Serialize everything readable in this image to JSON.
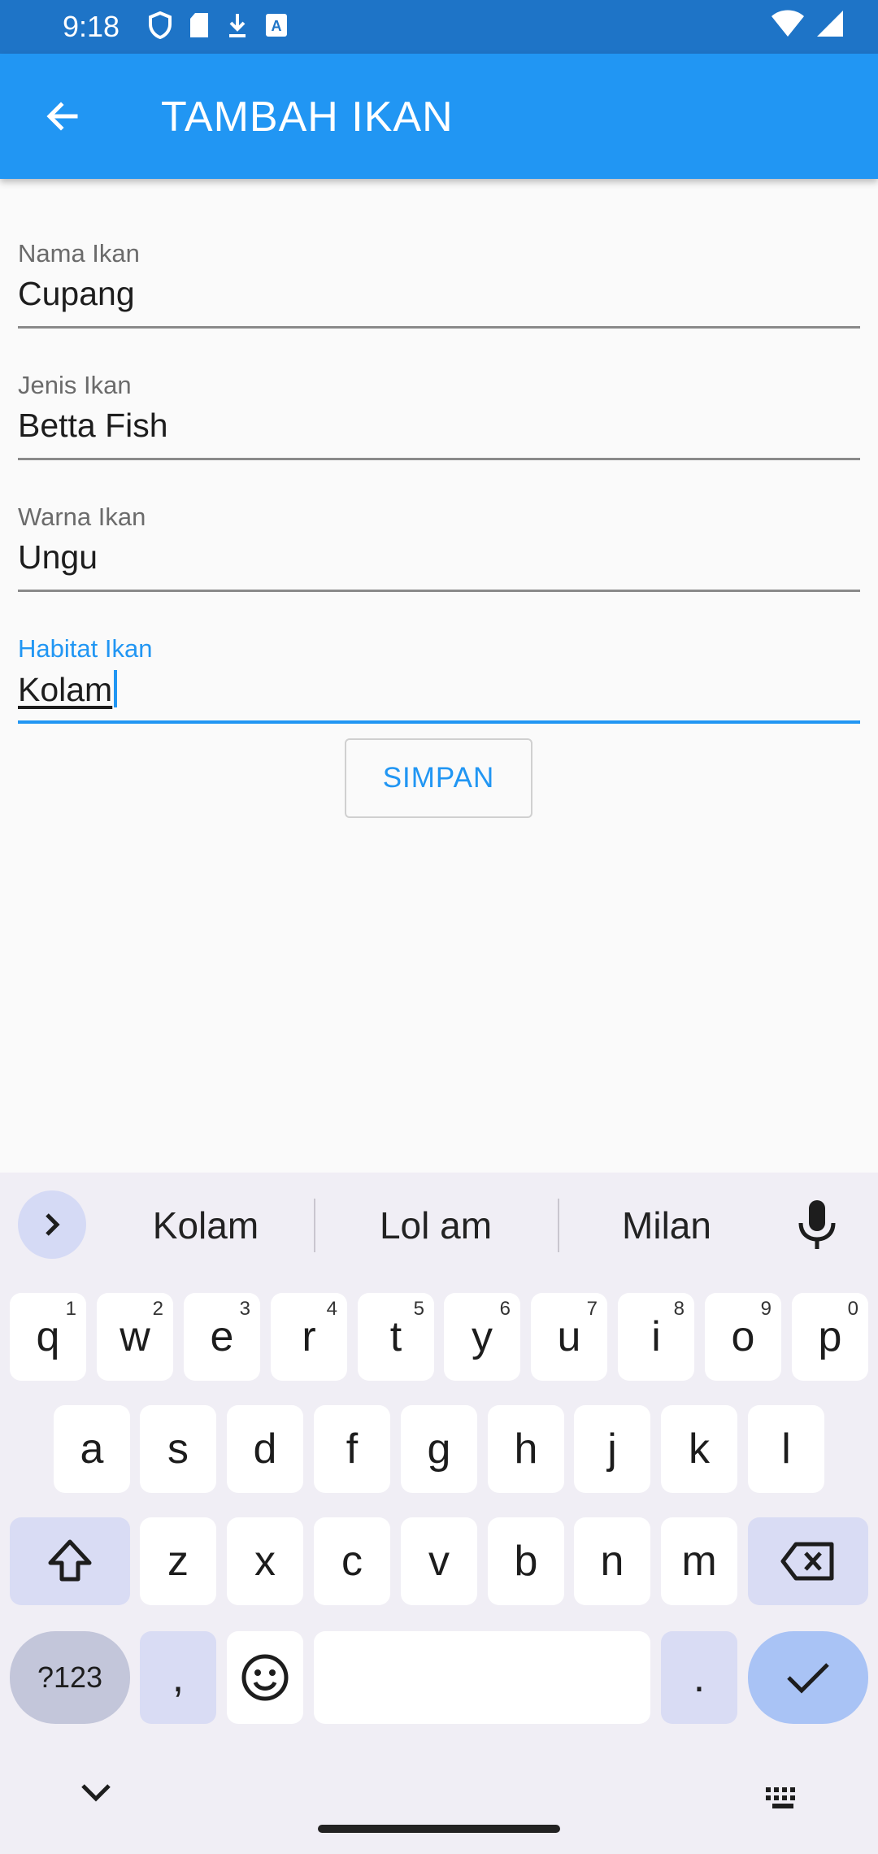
{
  "status_bar": {
    "time": "9:18"
  },
  "app_bar": {
    "title": "TAMBAH IKAN"
  },
  "form": {
    "fields": [
      {
        "label": "Nama Ikan",
        "value": "Cupang"
      },
      {
        "label": "Jenis Ikan",
        "value": "Betta Fish"
      },
      {
        "label": "Warna Ikan",
        "value": "Ungu"
      },
      {
        "label": "Habitat Ikan",
        "value": "Kolam"
      }
    ],
    "save_label": "SIMPAN"
  },
  "colors": {
    "primary": "#2196f3",
    "status_bar": "#1e74c7"
  },
  "keyboard": {
    "suggestions": [
      "Kolam",
      "Lol am",
      "Milan"
    ],
    "row1": [
      "q",
      "w",
      "e",
      "r",
      "t",
      "y",
      "u",
      "i",
      "o",
      "p"
    ],
    "row1_hints": [
      "1",
      "2",
      "3",
      "4",
      "5",
      "6",
      "7",
      "8",
      "9",
      "0"
    ],
    "row2": [
      "a",
      "s",
      "d",
      "f",
      "g",
      "h",
      "j",
      "k",
      "l"
    ],
    "row3": [
      "z",
      "x",
      "c",
      "v",
      "b",
      "n",
      "m"
    ],
    "symbols_label": "?123",
    "comma": ",",
    "period": "."
  }
}
